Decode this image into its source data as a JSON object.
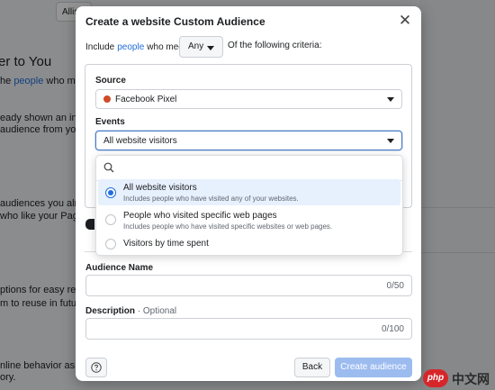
{
  "background": {
    "top_button": "Allis",
    "heading": "er to You",
    "line1_before": "he",
    "line1_link": "people",
    "line1_after": "who matter",
    "line2": "eady shown an interest",
    "line3": "audience from your c",
    "line4": "audiences you already",
    "line5": "who like your Page, con",
    "line6": "ptions for easy reuse.",
    "line7": "m to reuse in future a",
    "line8": "nline behavior as your",
    "line9": "ory."
  },
  "modal": {
    "title": "Create a website Custom Audience",
    "criteria_prefix": "Include",
    "criteria_link": "people",
    "criteria_middle": "who meet",
    "criteria_select": "Any",
    "criteria_suffix": "Of the following criteria:",
    "source_label": "Source",
    "source_value": "Facebook Pixel",
    "events_label": "Events",
    "events_value": "All website visitors",
    "dropdown": {
      "search_placeholder": "",
      "options": [
        {
          "title": "All website visitors",
          "desc": "Includes people who have visited any of your websites.",
          "selected": true
        },
        {
          "title": "People who visited specific web pages",
          "desc": "Includes people who have visited specific websites or web pages.",
          "selected": false
        },
        {
          "title": "Visitors by time spent",
          "desc": "",
          "selected": false
        }
      ]
    },
    "audience_name_label": "Audience Name",
    "audience_name_count": "0/50",
    "description_label": "Description",
    "description_optional": "· Optional",
    "description_count": "0/100",
    "back_label": "Back",
    "create_label": "Create audience"
  },
  "colors": {
    "accent": "#216fdb",
    "pixel_dot": "#d14b29",
    "create_disabled": "#9cbcf0"
  },
  "watermark": {
    "badge": "php",
    "text": "中文网"
  }
}
